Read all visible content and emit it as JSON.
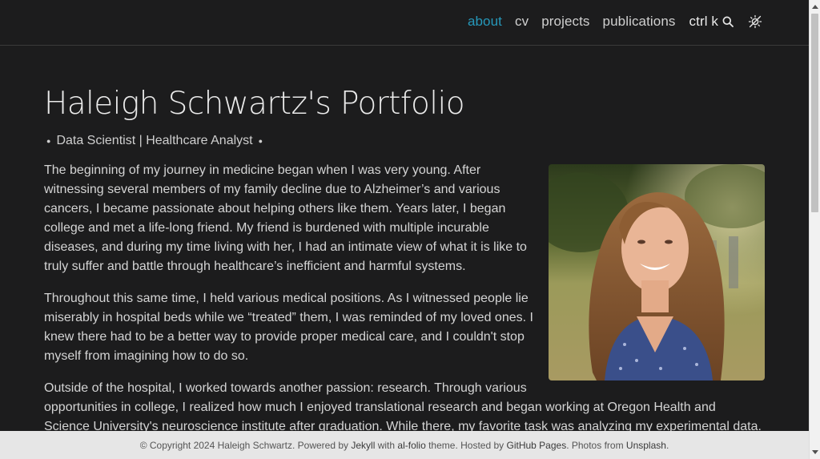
{
  "nav": {
    "items": [
      {
        "label": "about",
        "active": true
      },
      {
        "label": "cv",
        "active": false
      },
      {
        "label": "projects",
        "active": false
      },
      {
        "label": "publications",
        "active": false
      }
    ],
    "search_label": "ctrl k",
    "search_icon": "search-icon",
    "theme_icon": "theme-toggle-icon",
    "active_color": "#2698ba"
  },
  "page": {
    "title": "Haleigh Schwartz's Portfolio",
    "subtitle": "Data Scientist | Healthcare Analyst",
    "paragraphs": [
      "The beginning of my journey in medicine began when I was very young. After witnessing several members of my family decline due to Alzheimer’s and various cancers, I became passionate about helping others like them. Years later, I began college and met a life-long friend. My friend is burdened with multiple incurable diseases, and during my time living with her, I had an intimate view of what it is like to truly suffer and battle through healthcare’s inefficient and harmful systems.",
      "Throughout this same time, I held various medical positions. As I witnessed people lie miserably in hospital beds while we “treated” them, I was reminded of my loved ones. I knew there had to be a better way to provide proper medical care, and I couldn't stop myself from imagining how to do so.",
      "Outside of the hospital, I worked towards another passion: research. Through various opportunities in college, I realized how much I enjoyed translational research and began working at Oregon Health and Science University's neuroscience institute after graduation. While there, my favorite task was analyzing my experimental data. I thrived"
    ]
  },
  "footer": {
    "copyright": "© Copyright 2024 Haleigh Schwartz. Powered by ",
    "jekyll": "Jekyll",
    "with": " with ",
    "alfolio": "al-folio",
    "theme": " theme. Hosted by ",
    "github": "GitHub Pages",
    "photos": ". Photos from ",
    "unsplash": "Unsplash",
    "end": "."
  }
}
